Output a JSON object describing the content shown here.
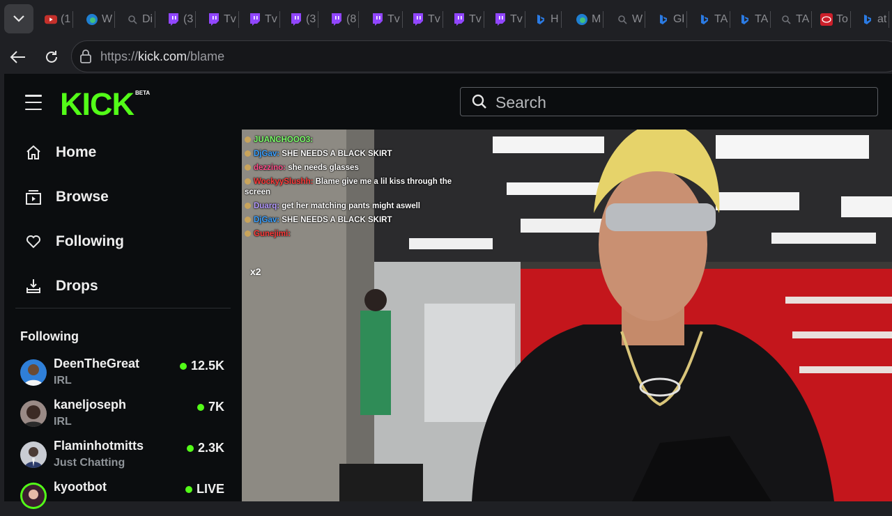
{
  "browser": {
    "tabs": [
      {
        "label": "(1",
        "icon": "youtube-icon",
        "color": "#c4302b"
      },
      {
        "label": "W",
        "icon": "edge-icon",
        "color": "#1f7fd1"
      },
      {
        "label": "Di",
        "icon": "search-icon",
        "color": "#6f7177"
      },
      {
        "label": "(3",
        "icon": "twitch-icon",
        "color": "#9146ff"
      },
      {
        "label": "Tv",
        "icon": "twitch-icon",
        "color": "#9146ff"
      },
      {
        "label": "Tv",
        "icon": "twitch-icon",
        "color": "#9146ff"
      },
      {
        "label": "(3",
        "icon": "twitch-icon",
        "color": "#9146ff"
      },
      {
        "label": "(8",
        "icon": "twitch-icon",
        "color": "#9146ff"
      },
      {
        "label": "Tv",
        "icon": "twitch-icon",
        "color": "#9146ff"
      },
      {
        "label": "Tv",
        "icon": "twitch-icon",
        "color": "#9146ff"
      },
      {
        "label": "Tv",
        "icon": "twitch-icon",
        "color": "#9146ff"
      },
      {
        "label": "Tv",
        "icon": "twitch-icon",
        "color": "#9146ff"
      },
      {
        "label": "H",
        "icon": "bing-icon",
        "color": "#2b7be4"
      },
      {
        "label": "M",
        "icon": "edge-icon",
        "color": "#1f7fd1"
      },
      {
        "label": "W",
        "icon": "search-icon",
        "color": "#6f7177"
      },
      {
        "label": "Gl",
        "icon": "bing-icon",
        "color": "#2b7be4"
      },
      {
        "label": "TA",
        "icon": "bing-icon",
        "color": "#2b7be4"
      },
      {
        "label": "TA",
        "icon": "bing-icon",
        "color": "#2b7be4"
      },
      {
        "label": "TA",
        "icon": "search-icon",
        "color": "#6f7177"
      },
      {
        "label": "To",
        "icon": "toyota-icon",
        "color": "#cc1f2a"
      },
      {
        "label": "at",
        "icon": "bing-icon",
        "color": "#2b7be4"
      }
    ],
    "url_prefix": "https://",
    "url_host": "kick.com",
    "url_path": "/blame"
  },
  "site": {
    "logo_text": "KICK",
    "beta_label": "BETA",
    "brand_color": "#53fc18",
    "search_placeholder": "Search",
    "nav": [
      {
        "label": "Home",
        "icon": "home-icon"
      },
      {
        "label": "Browse",
        "icon": "browse-icon"
      },
      {
        "label": "Following",
        "icon": "heart-icon"
      },
      {
        "label": "Drops",
        "icon": "drops-icon"
      }
    ],
    "following_heading": "Following",
    "following": [
      {
        "name": "DeenTheGreat",
        "category": "IRL",
        "viewers": "12.5K"
      },
      {
        "name": "kaneljoseph",
        "category": "IRL",
        "viewers": "7K"
      },
      {
        "name": "Flaminhotmitts",
        "category": "Just Chatting",
        "viewers": "2.3K"
      },
      {
        "name": "kyootbot",
        "category": "",
        "viewers": "LIVE"
      }
    ]
  },
  "stream": {
    "chat": [
      {
        "user": "JUANCHOOO3:",
        "text": "",
        "color": "#7cff6b"
      },
      {
        "user": "DjGav:",
        "text": "SHE NEEDS A BLACK SKIRT",
        "color": "#3aa0ff"
      },
      {
        "user": "dezzino:",
        "text": "she needs glasses",
        "color": "#ff4f8b"
      },
      {
        "user": "WockyySlushh:",
        "text": "Blame give me a lil kiss through the screen",
        "color": "#ff3b3b"
      },
      {
        "user": "Duarq:",
        "text": "get her matching pants might aswell",
        "color": "#b59bff"
      },
      {
        "user": "DjGav:",
        "text": "SHE NEEDS A BLACK SKIRT",
        "color": "#3aa0ff"
      },
      {
        "user": "Gunejimi:",
        "text": "",
        "color": "#ff3b3b"
      }
    ],
    "combo_label": "x2"
  }
}
